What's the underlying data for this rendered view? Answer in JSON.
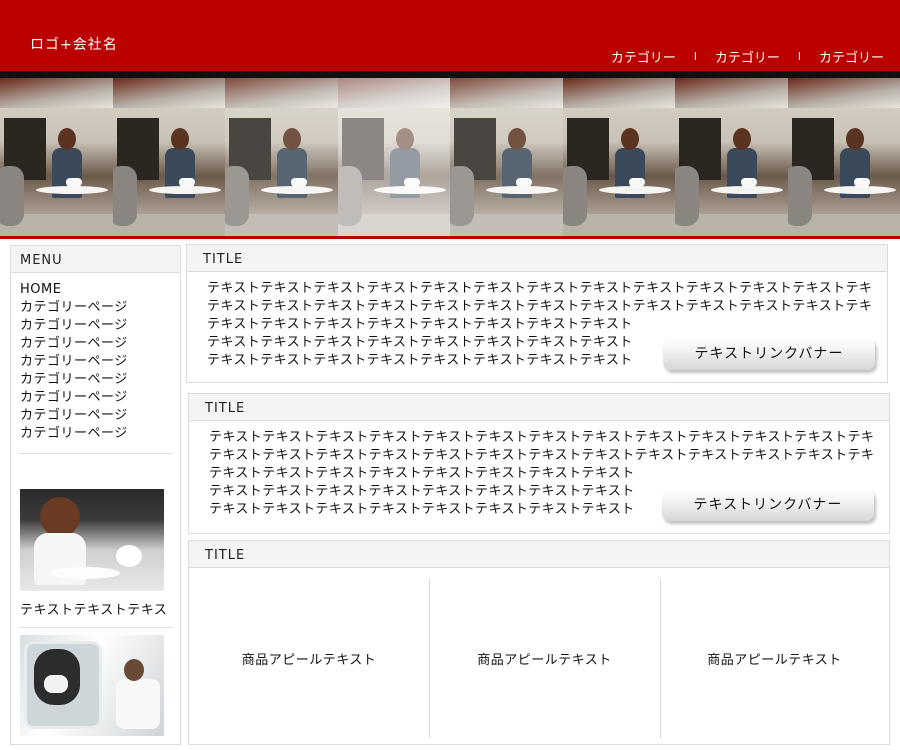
{
  "header": {
    "logo": "ロゴ+会社名",
    "nav": [
      "カテゴリー",
      "カテゴリー",
      "カテゴリー"
    ],
    "nav_separator": "l"
  },
  "hero": {
    "tile_count": 8,
    "tile_opacity": [
      1,
      1,
      0.85,
      0.55,
      0.85,
      1,
      1,
      1
    ]
  },
  "sidebar": {
    "menu_title": "MENU",
    "items": [
      "HOME",
      "カテゴリーページ",
      "カテゴリーページ",
      "カテゴリーページ",
      "カテゴリーページ",
      "カテゴリーページ",
      "カテゴリーページ",
      "カテゴリーページ",
      "カテゴリーページ",
      "カテゴリーページ"
    ],
    "photo_caption": "テキストテキストテキス"
  },
  "panels": [
    {
      "title": "TITLE",
      "lines": [
        "テキストテキストテキストテキストテキストテキストテキストテキストテキストテキストテキストテキストテキ",
        "テキストテキストテキストテキストテキストテキストテキストテキストテキストテキストテキストテキストテキ",
        "テキストテキストテキストテキストテキストテキストテキストテキスト",
        "テキストテキストテキストテキストテキストテキストテキストテキスト",
        "テキストテキストテキストテキストテキストテキストテキストテキスト"
      ],
      "banner": "テキストリンクバナー"
    },
    {
      "title": "TITLE",
      "lines": [
        "テキストテキストテキストテキストテキストテキストテキストテキストテキストテキストテキストテキストテキ",
        "テキストテキストテキストテキストテキストテキストテキストテキストテキストテキストテキストテキストテキ",
        "テキストテキストテキストテキストテキストテキストテキストテキスト",
        "テキストテキストテキストテキストテキストテキストテキストテキスト",
        "テキストテキストテキストテキストテキストテキストテキストテキスト"
      ],
      "banner": "テキストリンクバナー"
    },
    {
      "title": "TITLE",
      "products": [
        "商品アピールテキスト",
        "商品アピールテキスト",
        "商品アピールテキスト"
      ]
    }
  ],
  "colors": {
    "header_red": "#bb0000",
    "dark_bar": "#101010",
    "border_gray": "#dcdcdc",
    "head_bg": "#f4f4f4"
  }
}
